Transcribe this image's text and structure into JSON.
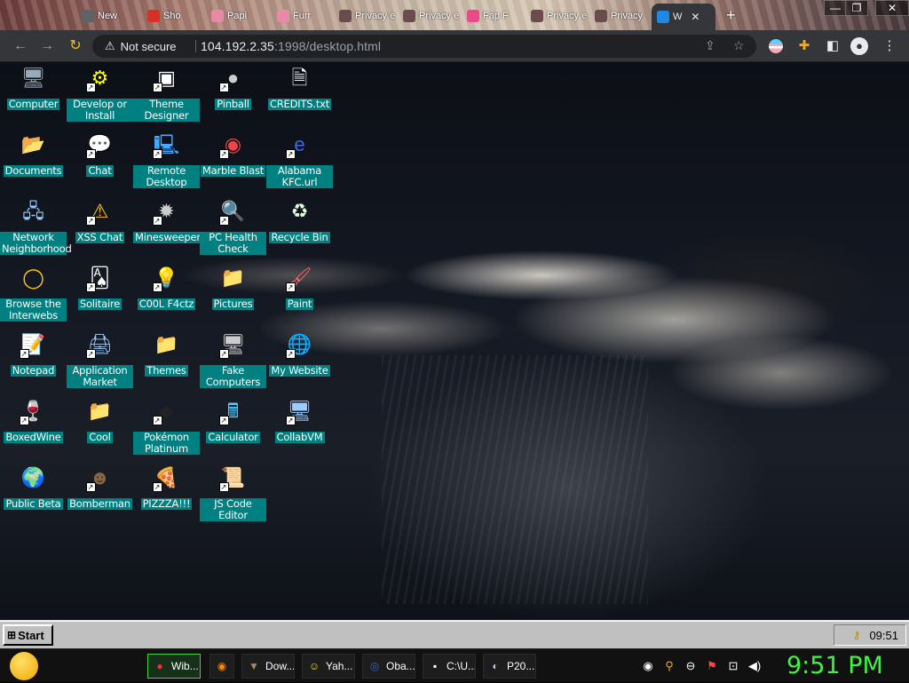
{
  "browser": {
    "tabs": [
      {
        "label": "New",
        "color": "#5f6368"
      },
      {
        "label": "Sho",
        "color": "#d93025"
      },
      {
        "label": "Papi",
        "color": "#e88aa6"
      },
      {
        "label": "Furr",
        "color": "#e88aa6"
      },
      {
        "label": "Privacy e",
        "color": "#6a4c4c"
      },
      {
        "label": "Privacy e",
        "color": "#6a4c4c"
      },
      {
        "label": "Fap F",
        "color": "#e84a8a"
      },
      {
        "label": "Privacy e",
        "color": "#6a4c4c"
      },
      {
        "label": "Privacy",
        "color": "#6a4c4c"
      }
    ],
    "active_tab": {
      "label": "W",
      "close": "✕"
    },
    "new_tab": "+",
    "window_controls": {
      "minimize": "—",
      "restore": "❐",
      "close": "✕"
    },
    "address": {
      "security_label": "Not secure",
      "url_host": "104.192.2.35",
      "url_rest": ":1998/desktop.html"
    }
  },
  "desktop_icons": [
    {
      "label": "Computer",
      "icon": "computer",
      "shortcut": false
    },
    {
      "label": "Develop or Install",
      "icon": "setup",
      "shortcut": true
    },
    {
      "label": "Theme Designer",
      "icon": "window",
      "shortcut": true
    },
    {
      "label": "Pinball",
      "icon": "pinball",
      "shortcut": true
    },
    {
      "label": "CREDITS.txt",
      "icon": "text-file",
      "shortcut": false
    },
    {
      "label": "Documents",
      "icon": "folder-open",
      "shortcut": false
    },
    {
      "label": "Chat",
      "icon": "chat-bubble",
      "shortcut": true
    },
    {
      "label": "Remote Desktop",
      "icon": "remote-desktop",
      "shortcut": true
    },
    {
      "label": "Marble Blast",
      "icon": "marble",
      "shortcut": true
    },
    {
      "label": "Alabama KFC.url",
      "icon": "internet-shortcut",
      "shortcut": true
    },
    {
      "label": "Network Neighborhood",
      "icon": "network",
      "shortcut": false
    },
    {
      "label": "XSS Chat",
      "icon": "chat-warning",
      "shortcut": true
    },
    {
      "label": "Minesweeper",
      "icon": "mine",
      "shortcut": true
    },
    {
      "label": "PC Health Check",
      "icon": "health-check",
      "shortcut": true
    },
    {
      "label": "Recycle Bin",
      "icon": "recycle-bin",
      "shortcut": false
    },
    {
      "label": "Browse the Interwebs",
      "icon": "browser",
      "shortcut": false
    },
    {
      "label": "Solitaire",
      "icon": "cards",
      "shortcut": true
    },
    {
      "label": "C00L F4ctz",
      "icon": "bulb",
      "shortcut": true
    },
    {
      "label": "Pictures",
      "icon": "folder",
      "shortcut": false
    },
    {
      "label": "Paint",
      "icon": "paint",
      "shortcut": true
    },
    {
      "label": "Notepad",
      "icon": "notepad",
      "shortcut": true
    },
    {
      "label": "Application Market",
      "icon": "market",
      "shortcut": true
    },
    {
      "label": "Themes",
      "icon": "folder",
      "shortcut": false
    },
    {
      "label": "Fake Computers",
      "icon": "fake-computer",
      "shortcut": true
    },
    {
      "label": "My Website",
      "icon": "globe",
      "shortcut": true
    },
    {
      "label": "BoxedWine",
      "icon": "wine",
      "shortcut": true
    },
    {
      "label": "Cool",
      "icon": "folder",
      "shortcut": false
    },
    {
      "label": "Pokémon Platinum",
      "icon": "pokemon",
      "shortcut": true
    },
    {
      "label": "Calculator",
      "icon": "calculator",
      "shortcut": true
    },
    {
      "label": "CollabVM",
      "icon": "collabvm",
      "shortcut": true
    },
    {
      "label": "Public Beta",
      "icon": "public-beta",
      "shortcut": false
    },
    {
      "label": "Bomberman",
      "icon": "bomberman",
      "shortcut": true
    },
    {
      "label": "PIZZZA!!!",
      "icon": "pizza",
      "shortcut": true
    },
    {
      "label": "JS Code Editor",
      "icon": "code-editor",
      "shortcut": true
    }
  ],
  "w98_taskbar": {
    "start_label": "Start",
    "clock": "09:51"
  },
  "host_taskbar": {
    "tasks": [
      {
        "label": "Wib...",
        "icon": "chrome",
        "active": true
      },
      {
        "label": "",
        "icon": "firefox",
        "active": false
      },
      {
        "label": "Dow...",
        "icon": "download",
        "active": false
      },
      {
        "label": "Yah...",
        "icon": "yahoo",
        "active": false
      },
      {
        "label": "Oba...",
        "icon": "obama",
        "active": false
      },
      {
        "label": "C:\\U...",
        "icon": "cmd",
        "active": false
      },
      {
        "label": "P20...",
        "icon": "paint",
        "active": false
      }
    ],
    "clock": "9:51 PM"
  }
}
